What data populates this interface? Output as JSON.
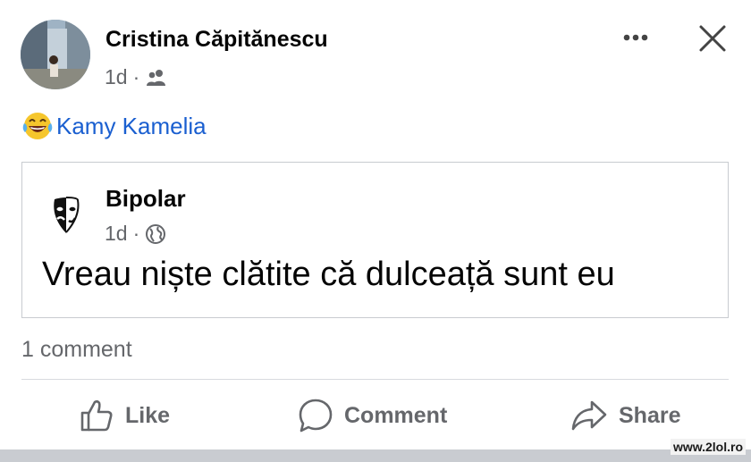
{
  "post": {
    "author": "Cristina Căpitănescu",
    "time": "1d",
    "separator": "·",
    "audience_icon": "friends-icon",
    "mention_emoji": "laughing-tears-emoji",
    "mention": "Kamy Kamelia"
  },
  "shared": {
    "author": "Bipolar",
    "time": "1d",
    "separator": "·",
    "audience_icon": "globe-icon",
    "text": "Vreau niște clătite că dulceață sunt eu"
  },
  "comments_count": "1 comment",
  "actions": {
    "like": "Like",
    "comment": "Comment",
    "share": "Share"
  },
  "watermark": "www.2lol.ro",
  "colors": {
    "link_blue": "#1a5fd0",
    "meta_gray": "#65676b",
    "text": "#050505"
  }
}
